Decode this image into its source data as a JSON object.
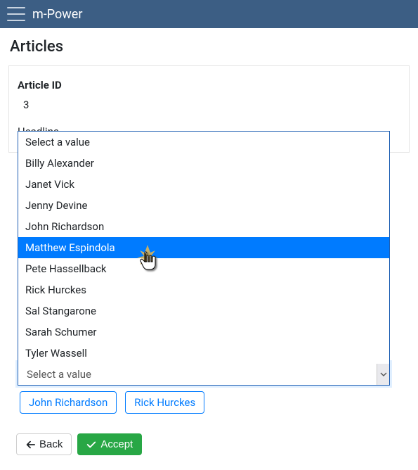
{
  "navbar": {
    "brand": "m-Power"
  },
  "page": {
    "title": "Articles"
  },
  "fields": {
    "article_id": {
      "label": "Article ID",
      "value": "3"
    },
    "headline": {
      "label": "Headline"
    }
  },
  "dropdown": {
    "placeholder": "Select a value",
    "selected_display": "Select a value",
    "highlighted_index": 5,
    "options": [
      "Select a value",
      "Billy Alexander",
      "Janet Vick",
      "Jenny Devine",
      "John Richardson",
      "Matthew Espindola",
      "Pete Hassellback",
      "Rick Hurckes",
      "Sal Stangarone",
      "Sarah Schumer",
      "Tyler Wassell"
    ]
  },
  "tokens": [
    "John Richardson",
    "Rick Hurckes"
  ],
  "buttons": {
    "back": "Back",
    "accept": "Accept"
  }
}
